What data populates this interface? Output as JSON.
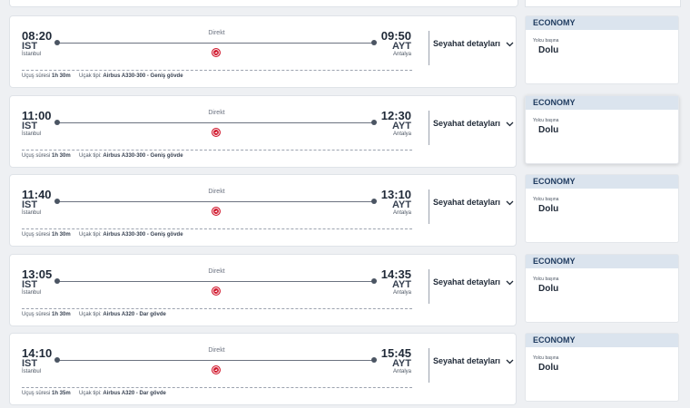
{
  "flights": [
    {
      "dep_time": "08:20",
      "dep_code": "IST",
      "dep_city": "İstanbul",
      "arr_time": "09:50",
      "arr_code": "AYT",
      "arr_city": "Antalya",
      "direct": "Direkt",
      "duration_label": "Uçuş süresi",
      "duration": "1h 30m",
      "aircraft_label": "Uçak tipi:",
      "aircraft": "Airbus A330-300 - Geniş gövde",
      "details": "Seyahat detayları",
      "cabin": "ECONOMY",
      "per_pax": "Yolcu başına",
      "status": "Dolu"
    },
    {
      "dep_time": "11:00",
      "dep_code": "IST",
      "dep_city": "İstanbul",
      "arr_time": "12:30",
      "arr_code": "AYT",
      "arr_city": "Antalya",
      "direct": "Direkt",
      "duration_label": "Uçuş süresi",
      "duration": "1h 30m",
      "aircraft_label": "Uçak tipi:",
      "aircraft": "Airbus A330-300 - Geniş gövde",
      "details": "Seyahat detayları",
      "cabin": "ECONOMY",
      "per_pax": "Yolcu başına",
      "status": "Dolu"
    },
    {
      "dep_time": "11:40",
      "dep_code": "IST",
      "dep_city": "İstanbul",
      "arr_time": "13:10",
      "arr_code": "AYT",
      "arr_city": "Antalya",
      "direct": "Direkt",
      "duration_label": "Uçuş süresi",
      "duration": "1h 30m",
      "aircraft_label": "Uçak tipi:",
      "aircraft": "Airbus A330-300 - Geniş gövde",
      "details": "Seyahat detayları",
      "cabin": "ECONOMY",
      "per_pax": "Yolcu başına",
      "status": "Dolu"
    },
    {
      "dep_time": "13:05",
      "dep_code": "IST",
      "dep_city": "İstanbul",
      "arr_time": "14:35",
      "arr_code": "AYT",
      "arr_city": "Antalya",
      "direct": "Direkt",
      "duration_label": "Uçuş süresi",
      "duration": "1h 30m",
      "aircraft_label": "Uçak tipi:",
      "aircraft": "Airbus A320 - Dar gövde",
      "details": "Seyahat detayları",
      "cabin": "ECONOMY",
      "per_pax": "Yolcu başına",
      "status": "Dolu"
    },
    {
      "dep_time": "14:10",
      "dep_code": "IST",
      "dep_city": "İstanbul",
      "arr_time": "15:45",
      "arr_code": "AYT",
      "arr_city": "Antalya",
      "direct": "Direkt",
      "duration_label": "Uçuş süresi",
      "duration": "1h 35m",
      "aircraft_label": "Uçak tipi:",
      "aircraft": "Airbus A320 - Dar gövde",
      "details": "Seyahat detayları",
      "cabin": "ECONOMY",
      "per_pax": "Yolcu başına",
      "status": "Dolu"
    }
  ],
  "icons": {
    "airline_logo": "turkish-airlines-logo-icon",
    "chevron": "chevron-down-icon"
  },
  "colors": {
    "accent": "#d0172c",
    "fare_header_bg": "#dbe4ee",
    "fare_header_text": "#1e3a5f"
  }
}
